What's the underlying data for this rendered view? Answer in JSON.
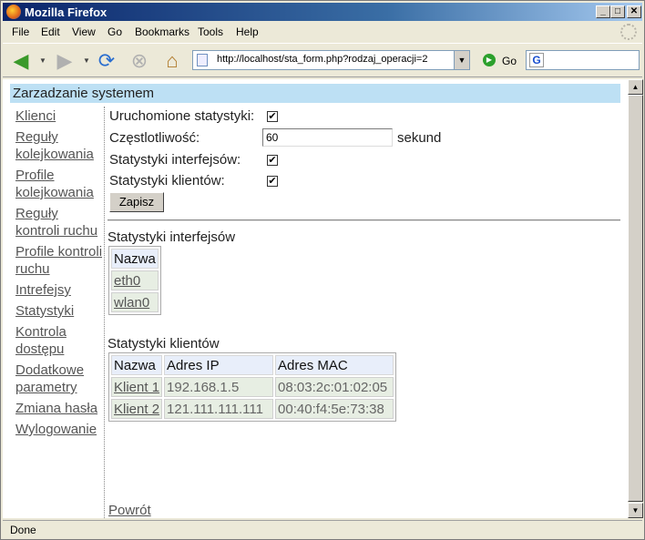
{
  "window": {
    "title": "Mozilla Firefox"
  },
  "menu": [
    "File",
    "Edit",
    "View",
    "Go",
    "Bookmarks",
    "Tools",
    "Help"
  ],
  "navbar": {
    "url": "http://localhost/sta_form.php?rodzaj_operacji=2",
    "go_label": "Go",
    "search_value": ""
  },
  "page": {
    "header": "Zarzadzanie systemem",
    "nav": {
      "klienci": "Klienci",
      "reguly_kolejkowania": "Reguły kolejkowania",
      "profile_kolejkowania": "Profile kolejkowania",
      "reguly_kontroli": "Reguły kontroli ruchu",
      "profile_kontroli": "Profile kontroli ruchu",
      "intrefejsy": "Intrefejsy",
      "statystyki": "Statystyki",
      "kontrola_dostepu": "Kontrola dostępu",
      "dodatkowe_parametry": "Dodatkowe parametry",
      "zmiana_hasla": "Zmiana hasła",
      "wylogowanie": "Wylogowanie"
    },
    "form": {
      "uruchomione_label": "Uruchomione statystyki:",
      "uruchomione_checked": true,
      "czestotliwosc_label": "Częstlotliwość:",
      "czestotliwosc_value": "60",
      "czestotliwosc_unit": "sekund",
      "interfejsow_label": "Statystyki interfejsów:",
      "interfejsow_checked": true,
      "klientow_label": "Statystyki klientów:",
      "klientow_checked": true,
      "save_label": "Zapisz"
    },
    "iface_stats": {
      "title": "Statystyki interfejsów",
      "header": "Nazwa",
      "rows": [
        "eth0",
        "wlan0"
      ]
    },
    "client_stats": {
      "title": "Statystyki klientów",
      "headers": [
        "Nazwa",
        "Adres IP",
        "Adres MAC"
      ],
      "rows": [
        [
          "Klient 1",
          "192.168.1.5",
          "08:03:2c:01:02:05"
        ],
        [
          "Klient 2",
          "121.111.111.111",
          "00:40:f4:5e:73:38"
        ]
      ]
    },
    "back_label": "Powrót"
  },
  "status": {
    "text": "Done"
  }
}
